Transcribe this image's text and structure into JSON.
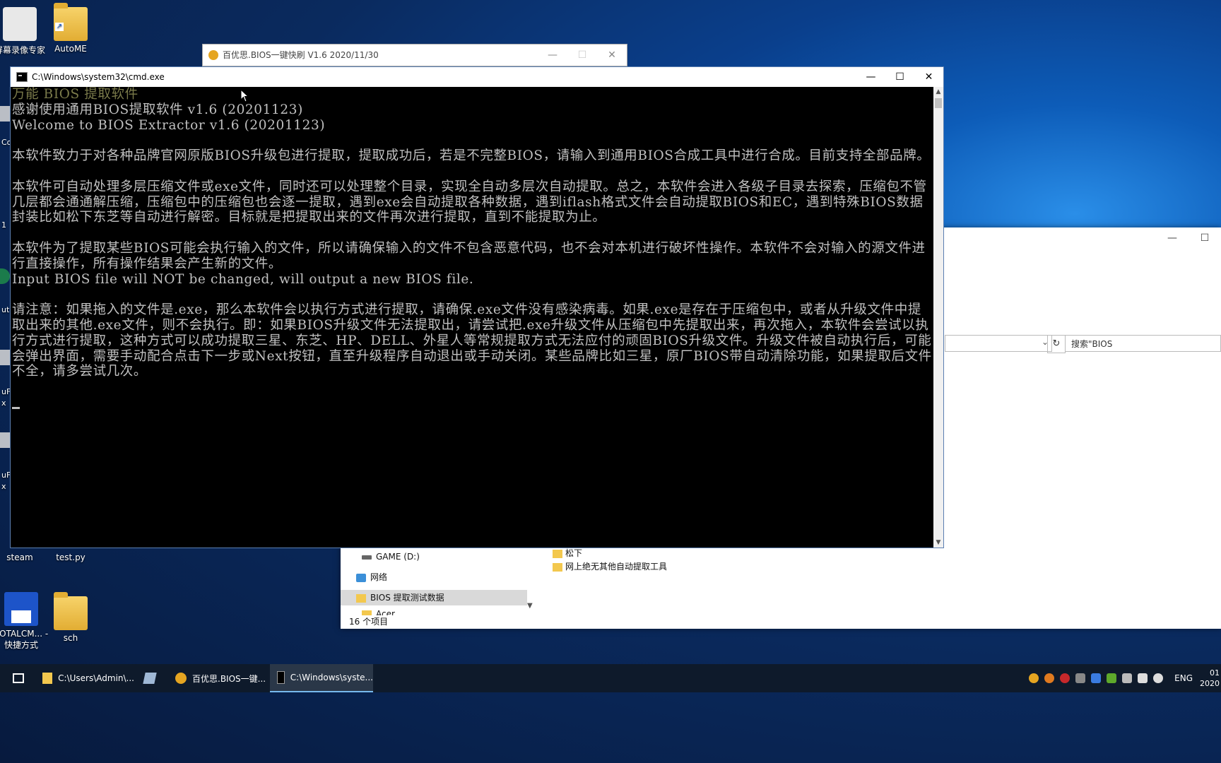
{
  "desktop": {
    "icons": [
      {
        "name": "screen-recorder",
        "label": "屏幕录像专家"
      },
      {
        "name": "autome",
        "label": "AutoME"
      },
      {
        "name": "steam",
        "label": "steam"
      },
      {
        "name": "test-py",
        "label": "test.py"
      },
      {
        "name": "totalcmd",
        "label": "TOTALCM... - 快捷方式"
      },
      {
        "name": "sch",
        "label": "sch"
      }
    ],
    "partial_labels": [
      "Co",
      "1",
      "ut",
      "uF",
      "x",
      "uF",
      "x"
    ]
  },
  "bios_window": {
    "title": "百优思.BIOS一键快刷 V1.6 2020/11/30",
    "min_icon": "—",
    "max_icon": "☐",
    "close_icon": "✕"
  },
  "explorer": {
    "search_placeholder": "搜索\"BIOS",
    "nav": [
      {
        "label": "GAME (D:)",
        "icon": "drive"
      },
      {
        "label": "网络",
        "icon": "network"
      },
      {
        "label": "BIOS 提取测试数据",
        "icon": "folder",
        "selected": true
      },
      {
        "label": "Acer",
        "icon": "folder"
      }
    ],
    "files": [
      "松下",
      "网上绝无其他自动提取工具"
    ],
    "status": "16 个项目"
  },
  "cmd": {
    "title": "C:\\Windows\\system32\\cmd.exe",
    "line1": "万能 BIOS 提取软件",
    "body": "感谢使用通用BIOS提取软件 v1.6 (20201123)\nWelcome to BIOS Extractor v1.6 (20201123)\n\n本软件致力于对各种品牌官网原版BIOS升级包进行提取，提取成功后，若是不完整BIOS，请输入到通用BIOS合成工具中进行合成。目前支持全部品牌。\n\n本软件可自动处理多层压缩文件或exe文件，同时还可以处理整个目录，实现全自动多层次自动提取。总之，本软件会进入各级子目录去探索，压缩包不管几层都会通通解压缩，压缩包中的压缩包也会逐一提取，遇到exe会自动提取各种数据，遇到iflash格式文件会自动提取BIOS和EC，遇到特殊BIOS数据封装比如松下东芝等自动进行解密。目标就是把提取出来的文件再次进行提取，直到不能提取为止。\n\n本软件为了提取某些BIOS可能会执行输入的文件，所以请确保输入的文件不包含恶意代码，也不会对本机进行破坏性操作。本软件不会对输入的源文件进行直接操作，所有操作结果会产生新的文件。\nInput BIOS file will NOT be changed, will output a new BIOS file.\n\n请注意：如果拖入的文件是.exe，那么本软件会以执行方式进行提取，请确保.exe文件没有感染病毒。如果.exe是存在于压缩包中，或者从升级文件中提取出来的其他.exe文件，则不会执行。即：如果BIOS升级文件无法提取出，请尝试把.exe升级文件从压缩包中先提取出来，再次拖入，本软件会尝试以执行方式进行提取，这种方式可以成功提取三星、东芝、HP、DELL、外星人等常规提取方式无法应付的顽固BIOS升级文件。升级文件被自动执行后，可能会弹出界面，需要手动配合点击下一步或Next按钮，直至升级程序自动退出或手动关闭。某些品牌比如三星，原厂BIOS带自动清除功能，如果提取后文件不全，请多尝试几次。\n\n"
  },
  "taskbar": {
    "items": [
      {
        "label": "C:\\Users\\Admin\\...",
        "icon": "folder"
      },
      {
        "label": "",
        "icon": "notepad"
      },
      {
        "label": "百优思.BIOS一键...",
        "icon": "bios"
      },
      {
        "label": "C:\\Windows\\syste...",
        "icon": "cmd",
        "active": true
      }
    ],
    "lang": "ENG",
    "time": "01",
    "date": "2020"
  }
}
